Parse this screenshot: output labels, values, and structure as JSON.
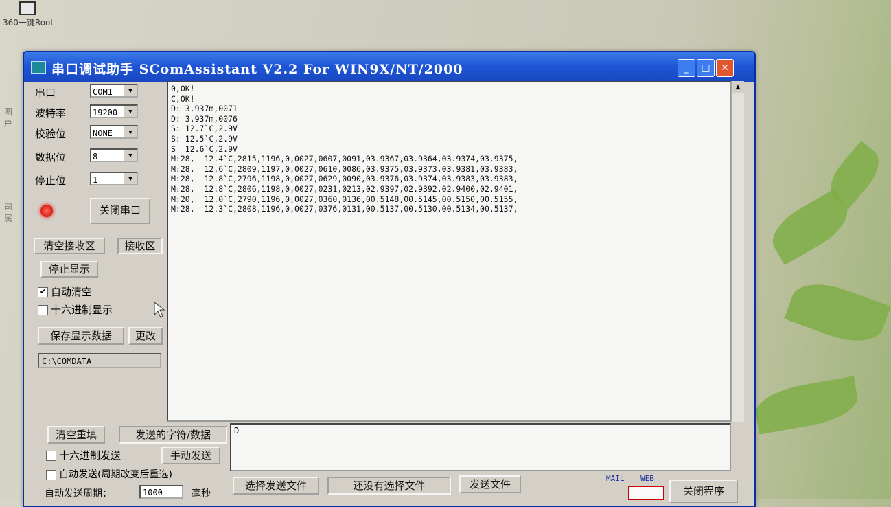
{
  "desktop": {
    "icon_label": "360一键Root",
    "side_text_1": "图\n户",
    "side_text_2": "司\n属"
  },
  "window": {
    "title": "串口调试助手 SComAssistant V2.2 For WIN9X/NT/2000",
    "min_glyph": "_",
    "max_glyph": "□",
    "close_glyph": "✕"
  },
  "settings": {
    "port_label": "串口",
    "port_value": "COM1",
    "baud_label": "波特率",
    "baud_value": "19200",
    "parity_label": "校验位",
    "parity_value": "NONE",
    "databits_label": "数据位",
    "databits_value": "8",
    "stopbits_label": "停止位",
    "stopbits_value": "1",
    "close_port_button": "关闭串口"
  },
  "receive_controls": {
    "clear_button": "清空接收区",
    "recv_label": "接收区",
    "stop_display_button": "停止显示",
    "auto_clear_label": "自动清空",
    "auto_clear_checked": "✔",
    "hex_display_label": "十六进制显示",
    "save_button": "保存显示数据",
    "change_button": "更改",
    "save_path": "C:\\COMDATA"
  },
  "receive_lines": [
    "0,OK!",
    "C,OK!",
    "D: 3.937m,0071",
    "D: 3.937m,0076",
    "S: 12.7`C,2.9V",
    "S: 12.5`C,2.9V",
    "S  12.6`C,2.9V",
    "M:28,  12.4`C,2815,1196,0,0027,0607,0091,03.9367,03.9364,03.9374,03.9375,",
    "M:28,  12.6`C,2809,1197,0,0027,0610,0086,03.9375,03.9373,03.9381,03.9383,",
    "M:28,  12.8`C,2796,1198,0,0027,0629,0090,03.9376,03.9374,03.9383,03.9383,",
    "M:28,  12.8`C,2806,1198,0,0027,0231,0213,02.9397,02.9392,02.9400,02.9401,",
    "M:20,  12.0`C,2790,1196,0,0027,0360,0136,00.5148,00.5145,00.5150,00.5155,",
    "M:28,  12.3`C,2808,1196,0,0027,0376,0131,00.5137,00.5130,00.5134,00.5137,"
  ],
  "send_controls": {
    "clear_refill_button": "清空重填",
    "send_chars_label": "发送的字符/数据",
    "send_text": "D",
    "hex_send_label": "十六进制发送",
    "manual_send_button": "手动发送",
    "auto_send_label": "自动发送(周期改变后重选)",
    "auto_period_label": "自动发送周期：",
    "period_value": "1000",
    "period_unit": "毫秒",
    "choose_file_button": "选择发送文件",
    "no_file_label": "还没有选择文件",
    "send_file_button": "发送文件",
    "mail_link": "MAIL",
    "web_link": "WEB",
    "close_program_button": "关闭程序"
  },
  "colors": {
    "title_bar": "#1f56d6",
    "led": "#e01010"
  }
}
